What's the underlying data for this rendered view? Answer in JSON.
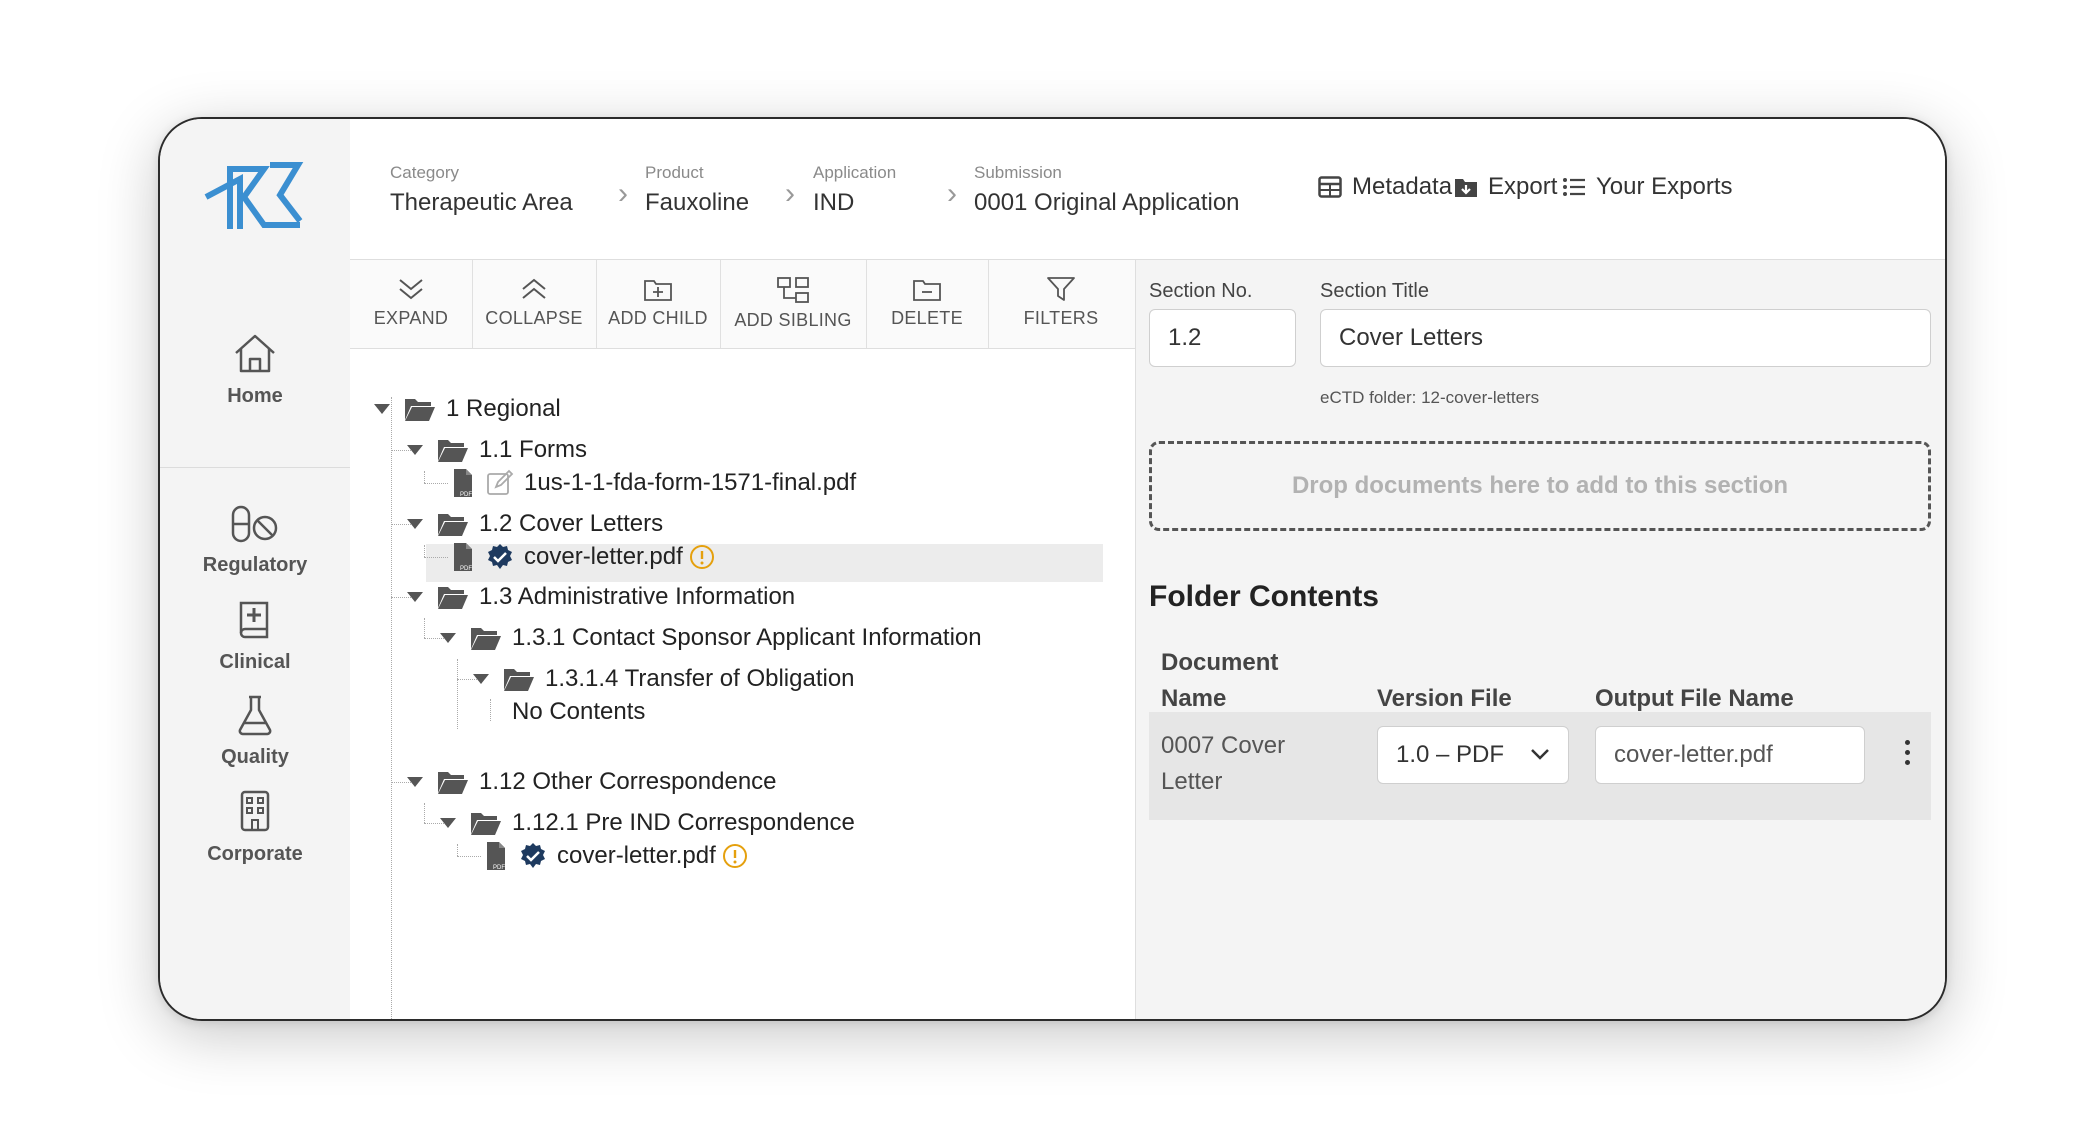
{
  "nav": {
    "items": [
      {
        "label": "Home",
        "icon": "home-icon"
      },
      {
        "label": "Regulatory",
        "icon": "pill-icon"
      },
      {
        "label": "Clinical",
        "icon": "medical-book-icon"
      },
      {
        "label": "Quality",
        "icon": "flask-icon"
      },
      {
        "label": "Corporate",
        "icon": "building-icon"
      }
    ]
  },
  "breadcrumb": [
    {
      "label": "Category",
      "value": "Therapeutic Area"
    },
    {
      "label": "Product",
      "value": "Fauxoline"
    },
    {
      "label": "Application",
      "value": "IND"
    },
    {
      "label": "Submission",
      "value": "0001 Original Application"
    }
  ],
  "header_actions": {
    "metadata": "Metadata",
    "export": "Export",
    "your_exports": "Your Exports"
  },
  "toolbar": {
    "expand": "EXPAND",
    "collapse": "COLLAPSE",
    "add_child": "ADD CHILD",
    "add_sibling": "ADD SIBLING",
    "delete": "DELETE",
    "filters": "FILTERS"
  },
  "tree": {
    "regional": "1 Regional",
    "forms": "1.1 Forms",
    "form_file": "1us-1-1-fda-form-1571-final.pdf",
    "cover_letters": "1.2 Cover Letters",
    "cover_file": "cover-letter.pdf",
    "admin": "1.3 Administrative Information",
    "contact": "1.3.1 Contact Sponsor Applicant Information",
    "transfer": "1.3.1.4 Transfer of Obligation",
    "no_contents": "No Contents",
    "other": "1.12 Other Correspondence",
    "pre_ind": "1.12.1 Pre IND Correspondence",
    "pre_ind_file": "cover-letter.pdf"
  },
  "section": {
    "no_label": "Section No.",
    "no_value": "1.2",
    "title_label": "Section Title",
    "title_value": "Cover Letters",
    "ectd_hint": "eCTD folder: 12-cover-letters"
  },
  "dropzone": "Drop documents here to add to this section",
  "folder_contents": {
    "title": "Folder Contents",
    "columns": [
      "Document Name",
      "Version File",
      "Output File Name"
    ],
    "rows": [
      {
        "document_name": "0007 Cover Letter",
        "version": "1.0 – PDF",
        "output": "cover-letter.pdf"
      }
    ]
  },
  "colors": {
    "accent": "#3b8fd1",
    "verified": "#1e3a5f",
    "warning": "#e5a00d"
  }
}
